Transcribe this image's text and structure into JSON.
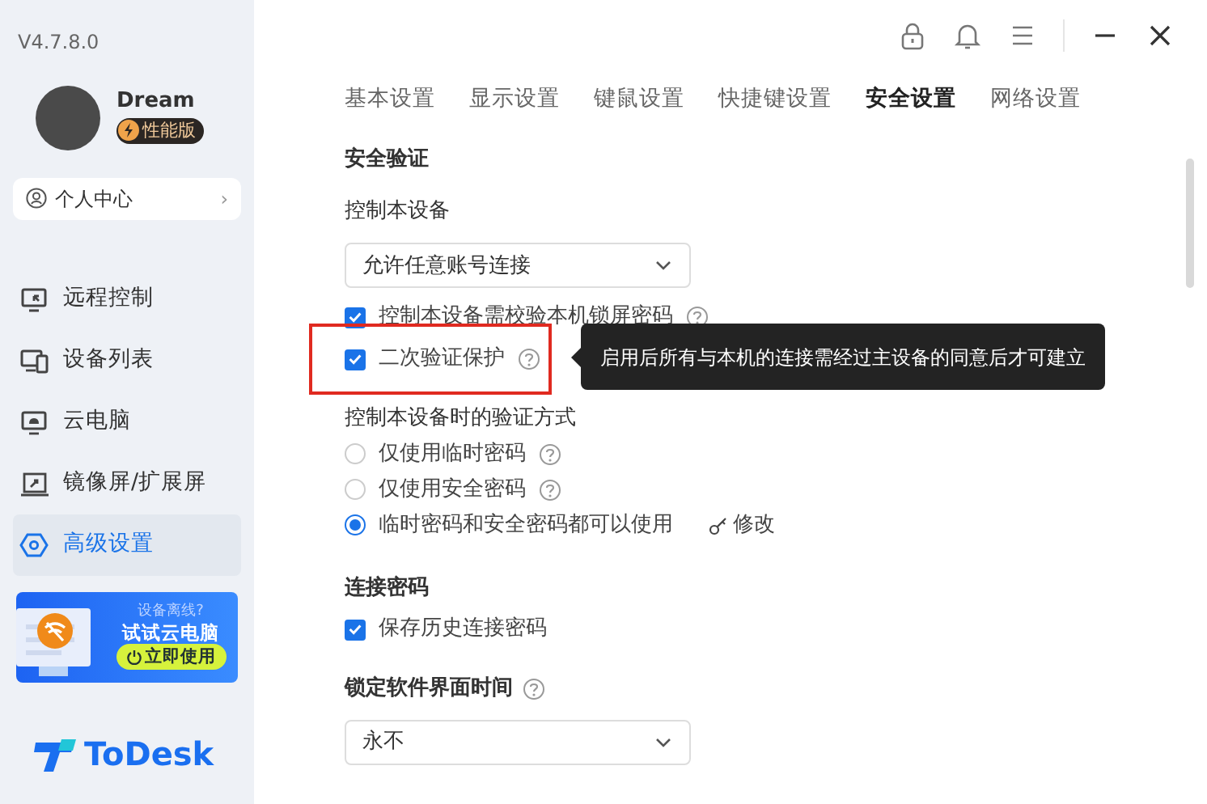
{
  "app": {
    "version": "V4.7.8.0"
  },
  "profile": {
    "name": "Dream",
    "badge": "性能版"
  },
  "personal_center": {
    "label": "个人中心",
    "chevron": "›"
  },
  "nav": [
    {
      "label": "远程控制",
      "selected": false
    },
    {
      "label": "设备列表",
      "selected": false
    },
    {
      "label": "云电脑",
      "selected": false
    },
    {
      "label": "镜像屏/扩展屏",
      "selected": false
    },
    {
      "label": "高级设置",
      "selected": true
    }
  ],
  "promo": {
    "tagline": "设备离线?",
    "title": "试试云电脑",
    "button": "立即使用"
  },
  "logo": {
    "text": "ToDesk"
  },
  "tabs": [
    {
      "label": "基本设置",
      "selected": false
    },
    {
      "label": "显示设置",
      "selected": false
    },
    {
      "label": "键鼠设置",
      "selected": false
    },
    {
      "label": "快捷键设置",
      "selected": false
    },
    {
      "label": "安全设置",
      "selected": true
    },
    {
      "label": "网络设置",
      "selected": false
    }
  ],
  "sections": [
    {
      "title": "安全验证",
      "items": [
        {
          "kind": "label",
          "text": "控制本设备"
        },
        {
          "kind": "select",
          "value": "允许任意账号连接"
        },
        {
          "kind": "checkbox",
          "label": "控制本设备需校验本机锁屏密码",
          "checked": true,
          "help": true
        },
        {
          "kind": "checkbox",
          "label": "二次验证保护",
          "checked": true,
          "help": true,
          "highlighted": true,
          "tooltip": "启用后所有与本机的连接需经过主设备的同意后才可建立"
        },
        {
          "kind": "label",
          "text": "控制本设备时的验证方式"
        },
        {
          "kind": "radio",
          "label": "仅使用临时密码",
          "selected": false,
          "help": true
        },
        {
          "kind": "radio",
          "label": "仅使用安全密码",
          "selected": false,
          "help": true
        },
        {
          "kind": "radio",
          "label": "临时密码和安全密码都可以使用",
          "selected": true,
          "link": "修改"
        }
      ]
    },
    {
      "title": "连接密码",
      "items": [
        {
          "kind": "checkbox",
          "label": "保存历史连接密码",
          "checked": true
        }
      ]
    },
    {
      "title": "锁定软件界面时间",
      "help": true,
      "items": [
        {
          "kind": "select",
          "value": "永不"
        }
      ]
    }
  ]
}
